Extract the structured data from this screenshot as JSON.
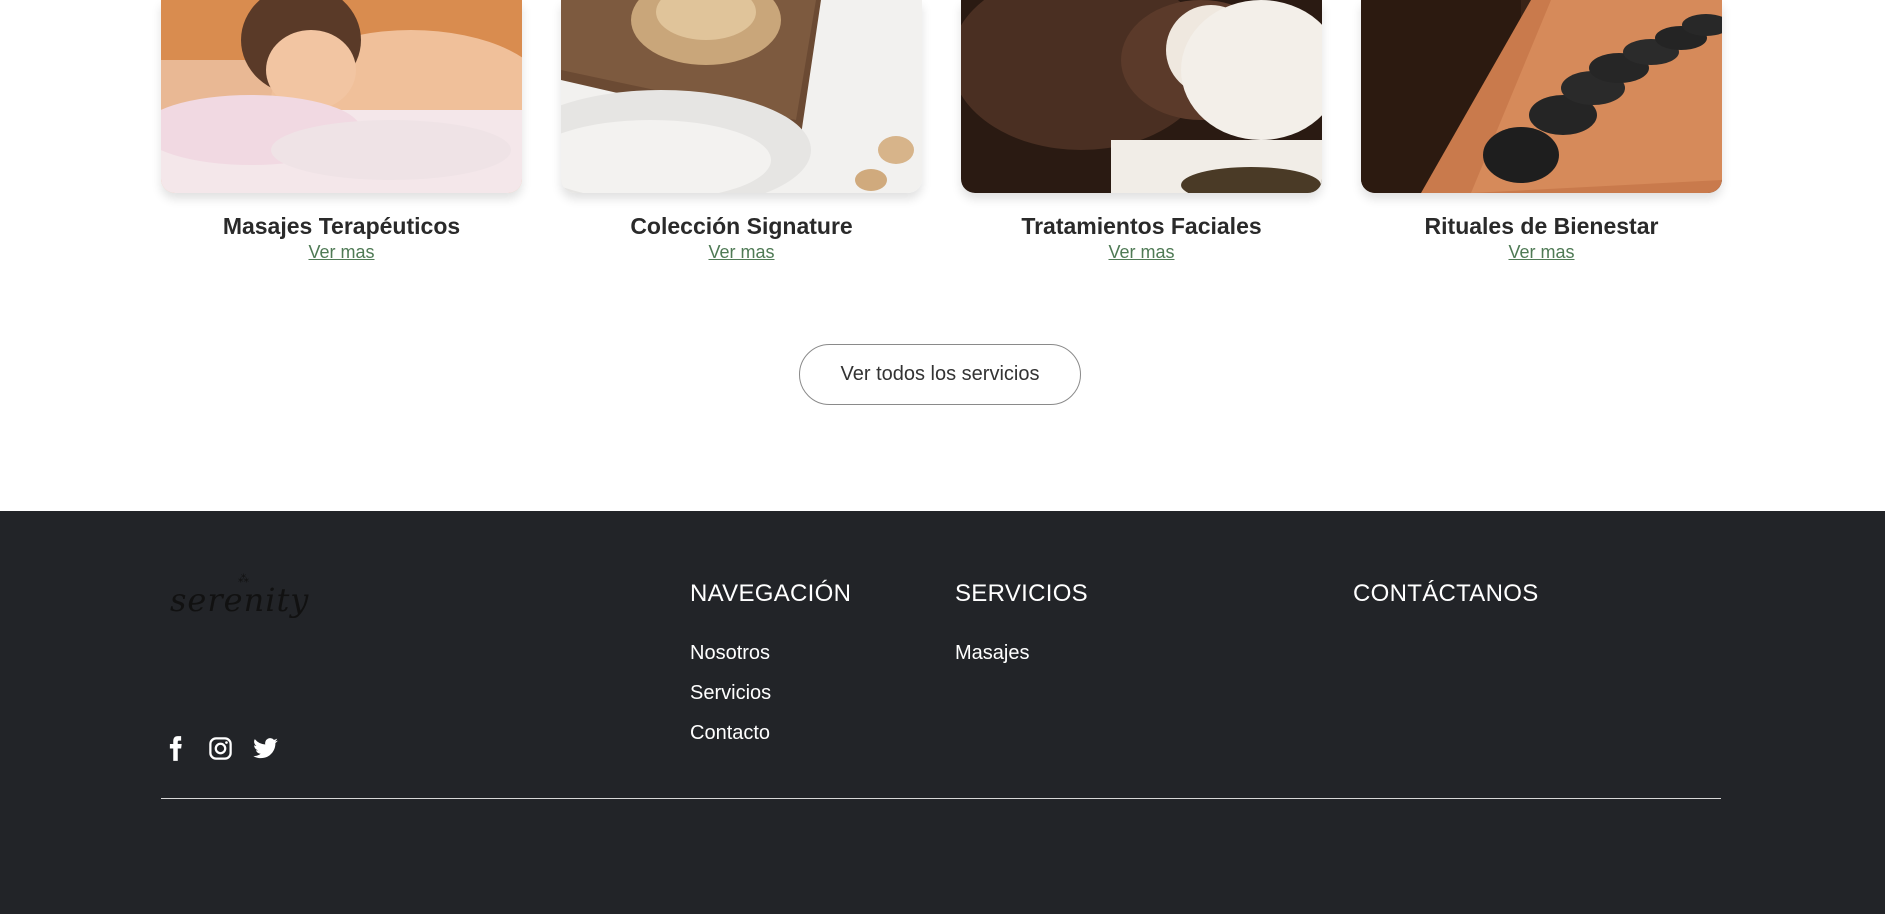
{
  "services": {
    "cards": [
      {
        "title": "Masajes Terapéuticos",
        "link": "Ver mas"
      },
      {
        "title": "Colección Signature",
        "link": "Ver mas"
      },
      {
        "title": "Tratamientos Faciales",
        "link": "Ver mas"
      },
      {
        "title": "Rituales de Bienestar",
        "link": "Ver mas"
      }
    ],
    "all_button": "Ver todos los servicios"
  },
  "footer": {
    "logo_text": "serenity",
    "social_icons": [
      "facebook-icon",
      "instagram-icon",
      "twitter-icon"
    ],
    "navigation": {
      "heading": "NAVEGACIÓN",
      "items": [
        "Nosotros",
        "Servicios",
        "Contacto"
      ]
    },
    "services": {
      "heading": "SERVICIOS",
      "items": [
        "Masajes"
      ]
    },
    "contact": {
      "heading": "CONTÁCTANOS"
    }
  },
  "colors": {
    "footer_bg": "#222428",
    "link_green": "#4f7a55"
  }
}
